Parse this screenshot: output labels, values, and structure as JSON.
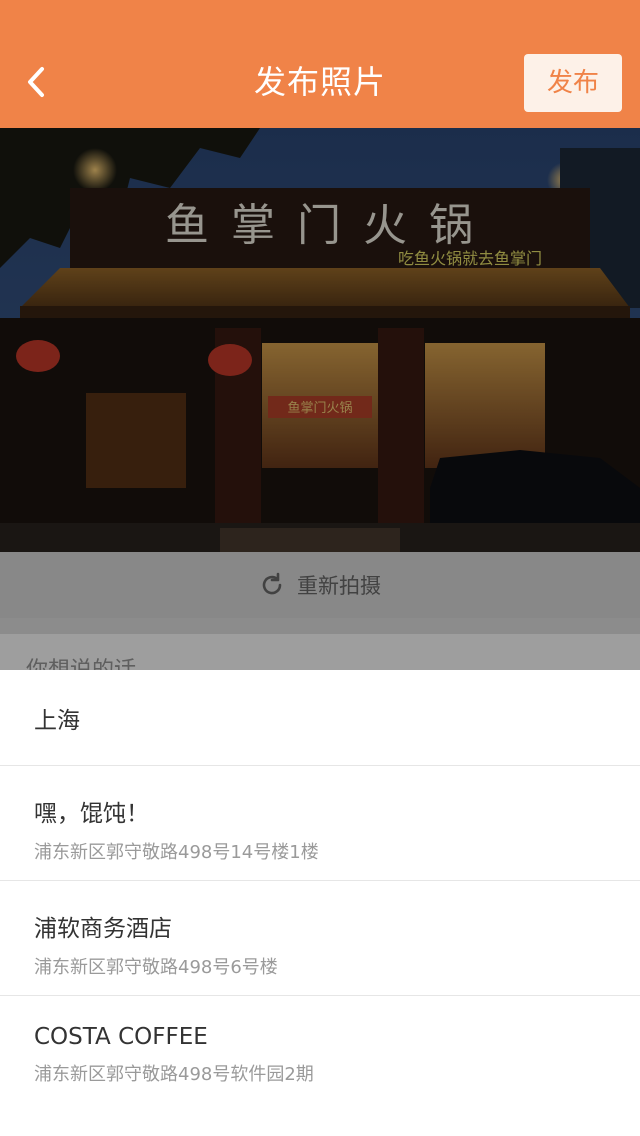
{
  "header": {
    "title": "发布照片",
    "publish_label": "发布",
    "accent_color": "#f08348"
  },
  "photo": {
    "sign_text": "鱼掌门火锅",
    "slogan_text": "吃鱼火锅就去鱼掌门",
    "window_sign_text": "鱼掌门火锅"
  },
  "retake": {
    "label": "重新拍摄",
    "icon": "refresh-icon"
  },
  "comment": {
    "placeholder": "你想说的话"
  },
  "locations": [
    {
      "name": "上海"
    },
    {
      "name": "嘿，馄饨！",
      "address": "浦东新区郭守敬路498号14号楼1楼"
    },
    {
      "name": "浦软商务酒店",
      "address": "浦东新区郭守敬路498号6号楼"
    },
    {
      "name": "COSTA COFFEE",
      "address": "浦东新区郭守敬路498号软件园2期"
    }
  ]
}
